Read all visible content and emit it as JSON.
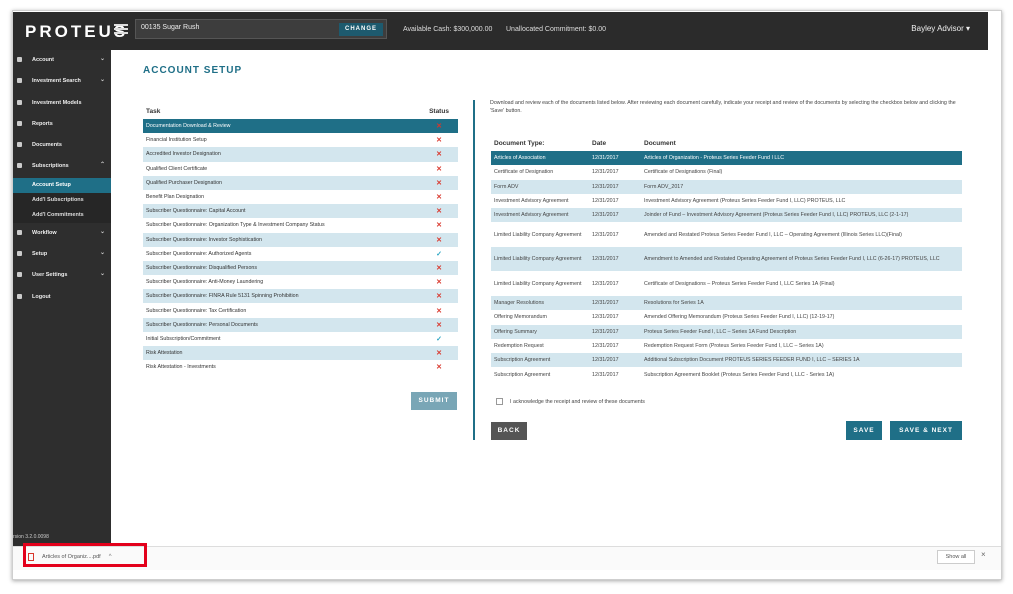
{
  "topbar": {
    "logo": "PROTEUS",
    "account_name": "00135 Sugar Rush",
    "change_label": "CHANGE",
    "available_cash": "Available Cash: $300,000.00",
    "unallocated": "Unallocated Commitment: $0.00",
    "user": "Bayley Advisor ▾"
  },
  "sidebar": {
    "items": [
      {
        "label": "Account",
        "chevron": "⌄"
      },
      {
        "label": "Investment Search",
        "chevron": "⌄"
      },
      {
        "label": "Investment Models",
        "chevron": ""
      },
      {
        "label": "Reports",
        "chevron": ""
      },
      {
        "label": "Documents",
        "chevron": ""
      },
      {
        "label": "Subscriptions",
        "chevron": "⌃"
      }
    ],
    "sub_items": [
      {
        "label": "Account Setup"
      },
      {
        "label": "Add'l Subscriptions"
      },
      {
        "label": "Add'l Commitments"
      }
    ],
    "items2": [
      {
        "label": "Workflow",
        "chevron": "⌄"
      },
      {
        "label": "Setup",
        "chevron": "⌄"
      },
      {
        "label": "User Settings",
        "chevron": "⌄"
      },
      {
        "label": "Logout",
        "chevron": ""
      }
    ],
    "version": "rsion 3.2.0.0098"
  },
  "main": {
    "title": "ACCOUNT SETUP",
    "task_header": "Task",
    "status_header": "Status",
    "tasks": [
      {
        "name": "Documentation Download & Review",
        "status": "✕"
      },
      {
        "name": "Financial Institution Setup",
        "status": "✕"
      },
      {
        "name": "Accredited Investor Designation",
        "status": "✕"
      },
      {
        "name": "Qualified Client Certificate",
        "status": "✕"
      },
      {
        "name": "Qualified Purchaser Designation",
        "status": "✕"
      },
      {
        "name": "Benefit Plan Designation",
        "status": "✕"
      },
      {
        "name": "Subscriber Questionnaire: Capital Account",
        "status": "✕"
      },
      {
        "name": "Subscriber Questionnaire: Organization Type & Investment Company Status",
        "status": "✕"
      },
      {
        "name": "Subscriber Questionnaire: Investor Sophistication",
        "status": "✕"
      },
      {
        "name": "Subscriber Questionnaire: Authorized Agents",
        "status": "✓"
      },
      {
        "name": "Subscriber Questionnaire: Disqualified Persons",
        "status": "✕"
      },
      {
        "name": "Subscriber Questionnaire: Anti-Money Laundering",
        "status": "✕"
      },
      {
        "name": "Subscriber Questionnaire: FINRA Rule 5131 Spinning Prohibition",
        "status": "✕"
      },
      {
        "name": "Subscriber Questionnaire: Tax Certification",
        "status": "✕"
      },
      {
        "name": "Subscriber Questionnaire: Personal Documents",
        "status": "✕"
      },
      {
        "name": "Initial Subscription/Commitment",
        "status": "✓"
      },
      {
        "name": "Risk Attestation",
        "status": "✕"
      },
      {
        "name": "Risk Attestation - Investments",
        "status": "✕"
      }
    ],
    "submit_label": "SUBMIT",
    "doc_intro": "Download and review each of the documents listed below. After reviewing each document carefully, indicate your receipt and review of the documents by selecting the checkbox below and clicking the 'Save' button.",
    "doc_headers": {
      "type": "Document Type:",
      "date": "Date",
      "document": "Document"
    },
    "documents": [
      {
        "type": "Articles of Association",
        "date": "12/31/2017",
        "doc": "Articles of Organization - Proteus Series Feeder Fund I LLC"
      },
      {
        "type": "Certificate of Designation",
        "date": "12/31/2017",
        "doc": "Certificate of Designations (Final)"
      },
      {
        "type": "Form ADV",
        "date": "12/31/2017",
        "doc": "Form ADV_2017"
      },
      {
        "type": "Investment Advisory Agreement",
        "date": "12/31/2017",
        "doc": "Investment Advisory Agreement (Proteus Series Feeder Fund I, LLC) PROTEUS, LLC"
      },
      {
        "type": "Investment Advisory Agreement",
        "date": "12/31/2017",
        "doc": "Joinder of Fund – Investment Advisory Agreement (Proteus Series Feeder Fund I, LLC) PROTEUS, LLC (2-1-17)"
      },
      {
        "type": "Limited Liability Company Agreement",
        "date": "12/31/2017",
        "doc": "Amended and Restated Proteus Series Feeder Fund I, LLC – Operating Agreement (Illinois Series LLC)(Final)"
      },
      {
        "type": "Limited Liability Company Agreement",
        "date": "12/31/2017",
        "doc": "Amendment to Amended and Restated Operating Agreement of Proteus Series Feeder Fund I, LLC (6-26-17) PROTEUS, LLC"
      },
      {
        "type": "Limited Liability Company Agreement",
        "date": "12/31/2017",
        "doc": "Certificate of Designations – Proteus Series Feeder Fund I, LLC Series 1A (Final)"
      },
      {
        "type": "Manager Resolutions",
        "date": "12/31/2017",
        "doc": "Resolutions for Series 1A"
      },
      {
        "type": "Offering Memorandum",
        "date": "12/31/2017",
        "doc": "Amended Offering Memorandum (Proteus Series Feeder Fund I, LLC) (12-19-17)"
      },
      {
        "type": "Offering Summary",
        "date": "12/31/2017",
        "doc": "Proteus Series Feeder Fund I, LLC – Series 1A Fund Description"
      },
      {
        "type": "Redemption Request",
        "date": "12/31/2017",
        "doc": "Redemption Request Form (Proteus Series Feeder Fund I, LLC – Series 1A)"
      },
      {
        "type": "Subscription Agreement",
        "date": "12/31/2017",
        "doc": "Additional Subscription Document PROTEUS SERIES FEEDER FUND I, LLC – SERIES 1A"
      },
      {
        "type": "Subscription Agreement",
        "date": "12/31/2017",
        "doc": "Subscription Agreement Booklet (Proteus Series Feeder Fund I, LLC - Series 1A)"
      }
    ],
    "ack_label": "I acknowledge the receipt and review of these documents",
    "back_label": "BACK",
    "save_label": "SAVE",
    "save_next_label": "SAVE & NEXT"
  },
  "download_bar": {
    "file_name": "Articles of Organiz....pdf",
    "chevron": "^",
    "show_all": "Show all",
    "close": "×"
  },
  "colors": {
    "accent": "#1f6f87",
    "row_alt": "#d3e6ee",
    "error": "#d9362b",
    "ok": "#2aa5c2"
  }
}
